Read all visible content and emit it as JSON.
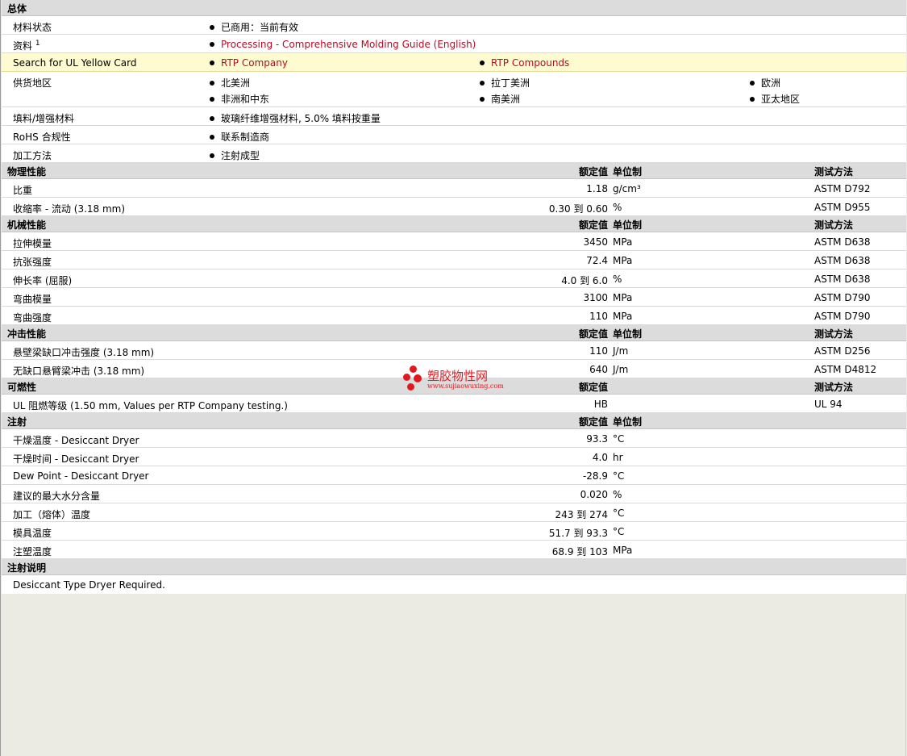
{
  "general": {
    "title": "总体",
    "status": {
      "label": "材料状态",
      "value": "已商用：当前有效"
    },
    "docs": {
      "label": "资料",
      "sup": "1",
      "value": "Processing - Comprehensive Molding Guide (English)"
    },
    "ul": {
      "label": "Search for UL Yellow Card",
      "v1": "RTP Company",
      "v2": "RTP Compounds"
    },
    "region": {
      "label": "供货地区",
      "items": [
        "北美洲",
        "拉丁美洲",
        "欧洲",
        "非洲和中东",
        "南美洲",
        "亚太地区"
      ]
    },
    "filler": {
      "label": "填料/增强材料",
      "value": "玻璃纤维增强材料, 5.0% 填料按重量"
    },
    "rohs": {
      "label": "RoHS 合规性",
      "value": "联系制造商"
    },
    "process": {
      "label": "加工方法",
      "value": "注射成型"
    }
  },
  "headers": {
    "rated": "额定值",
    "unit": "单位制",
    "method": "测试方法"
  },
  "physical": {
    "title": "物理性能",
    "rows": [
      {
        "name": "比重",
        "value": "1.18",
        "unit": "g/cm³",
        "method": "ASTM D792"
      },
      {
        "name": "收缩率  - 流动  (3.18 mm)",
        "value": "0.30 到  0.60",
        "unit": "%",
        "method": "ASTM D955"
      }
    ]
  },
  "mechanical": {
    "title": "机械性能",
    "rows": [
      {
        "name": "拉伸模量",
        "value": "3450",
        "unit": "MPa",
        "method": "ASTM D638"
      },
      {
        "name": "抗张强度",
        "value": "72.4",
        "unit": "MPa",
        "method": "ASTM D638"
      },
      {
        "name": "伸长率  (屈服)",
        "value": "4.0 到  6.0",
        "unit": "%",
        "method": "ASTM D638"
      },
      {
        "name": "弯曲模量",
        "value": "3100",
        "unit": "MPa",
        "method": "ASTM D790"
      },
      {
        "name": "弯曲强度",
        "value": "110",
        "unit": "MPa",
        "method": "ASTM D790"
      }
    ]
  },
  "impact": {
    "title": "冲击性能",
    "rows": [
      {
        "name": "悬壁梁缺口冲击强度  (3.18 mm)",
        "value": "110",
        "unit": "J/m",
        "method": "ASTM D256"
      },
      {
        "name": "无缺口悬臂梁冲击  (3.18 mm)",
        "value": "640",
        "unit": "J/m",
        "method": "ASTM D4812"
      }
    ]
  },
  "flammability": {
    "title": "可燃性",
    "rows": [
      {
        "name": "UL 阻燃等级  (1.50 mm, Values per RTP Company testing.)",
        "value": "HB",
        "unit": "",
        "method": "UL 94"
      }
    ]
  },
  "injection": {
    "title": "注射",
    "rows": [
      {
        "name": "干燥温度  - Desiccant Dryer",
        "value": "93.3",
        "unit": "°C"
      },
      {
        "name": "干燥时间  - Desiccant Dryer",
        "value": "4.0",
        "unit": "hr"
      },
      {
        "name": "Dew Point - Desiccant Dryer",
        "value": "-28.9",
        "unit": "°C"
      },
      {
        "name": "建议的最大水分含量",
        "value": "0.020",
        "unit": "%"
      },
      {
        "name": "加工（熔体）温度",
        "value": "243 到  274",
        "unit": "°C"
      },
      {
        "name": "模具温度",
        "value": "51.7 到  93.3",
        "unit": "°C"
      },
      {
        "name": "注塑温度",
        "value": "68.9 到  103",
        "unit": "MPa"
      }
    ]
  },
  "notes": {
    "title": "注射说明",
    "text": "Desiccant Type Dryer Required."
  },
  "watermark": {
    "title": "塑胶物性网",
    "url": "www.sujiaowuxing.com"
  }
}
